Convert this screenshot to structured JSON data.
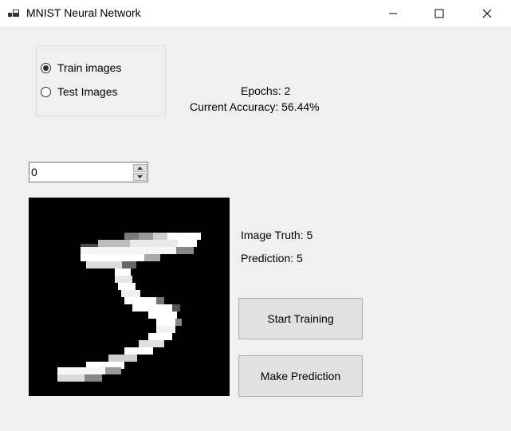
{
  "window": {
    "title": "MNIST Neural Network",
    "icons": [
      "app-icon",
      "minimize-icon",
      "maximize-icon",
      "close-icon"
    ]
  },
  "image_set": {
    "options": [
      {
        "label": "Train images",
        "checked": true
      },
      {
        "label": "Test Images",
        "checked": false
      }
    ]
  },
  "stats": {
    "epochs_text": "Epochs: 2",
    "accuracy_text": "Current Accuracy: 56.44%"
  },
  "image_index": {
    "value": "0"
  },
  "prediction": {
    "truth_text": "Image Truth: 5",
    "prediction_text": "Prediction: 5"
  },
  "buttons": {
    "start_training": "Start Training",
    "make_prediction": "Make Prediction"
  }
}
